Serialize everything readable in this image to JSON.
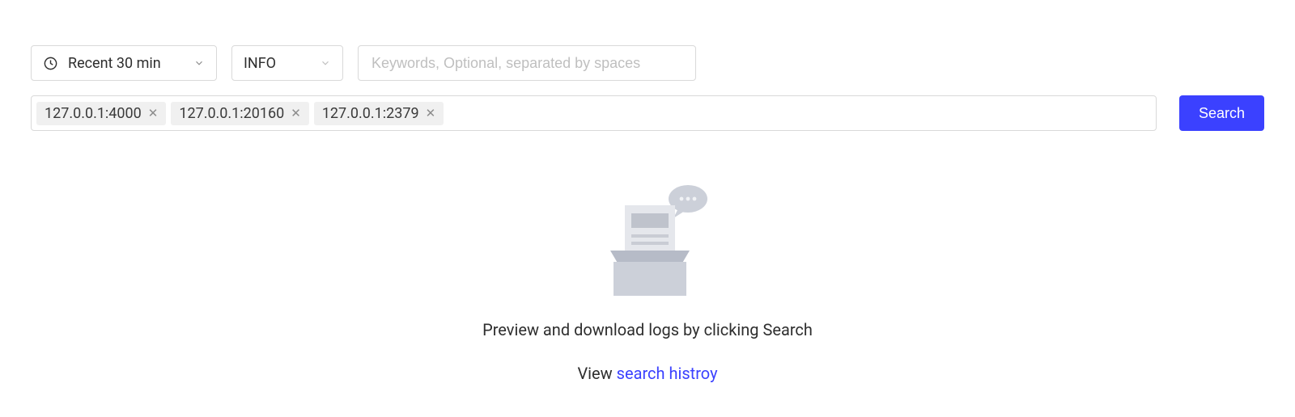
{
  "filters": {
    "time_range_label": "Recent 30 min",
    "log_level": "INFO",
    "keywords_placeholder": "Keywords, Optional, separated by spaces"
  },
  "instances": [
    "127.0.0.1:4000",
    "127.0.0.1:20160",
    "127.0.0.1:2379"
  ],
  "actions": {
    "search_label": "Search"
  },
  "empty_state": {
    "message": "Preview and download logs by clicking Search",
    "view_prefix": "View ",
    "history_link_text": "search histroy"
  }
}
